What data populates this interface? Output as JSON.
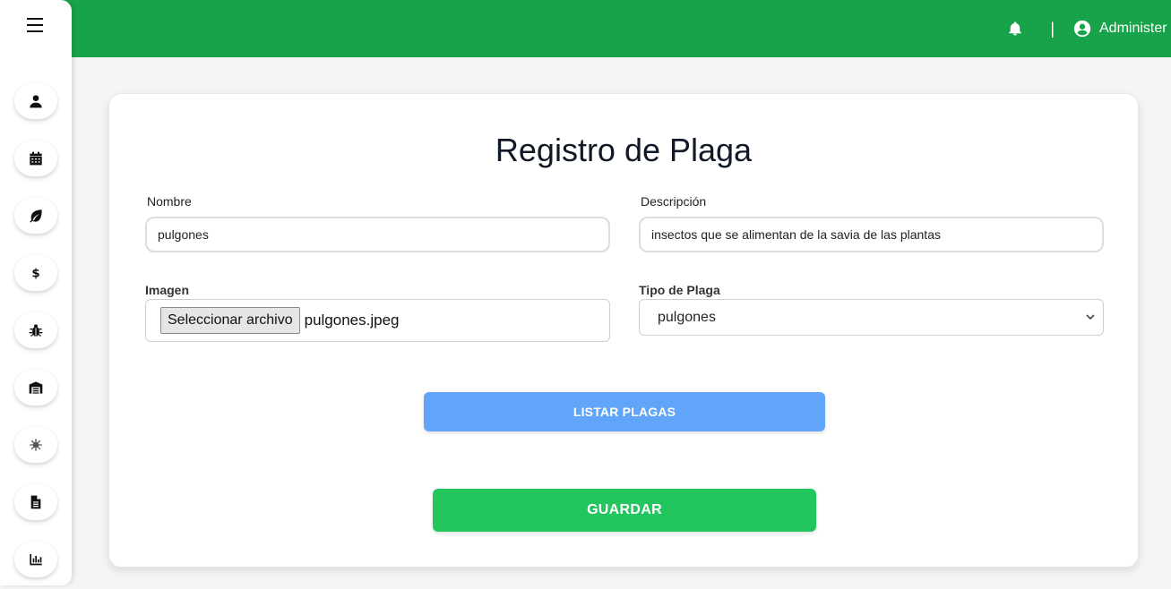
{
  "header": {
    "separator": "|",
    "user_name": "Administer"
  },
  "sidebar": {
    "items": [
      {
        "icon": "user-icon"
      },
      {
        "icon": "calendar-icon"
      },
      {
        "icon": "leaf-icon"
      },
      {
        "icon": "dollar-icon"
      },
      {
        "icon": "bug-icon"
      },
      {
        "icon": "warehouse-icon"
      },
      {
        "icon": "virus-icon"
      },
      {
        "icon": "file-icon"
      },
      {
        "icon": "chart-icon"
      }
    ]
  },
  "form": {
    "title": "Registro de Plaga",
    "nombre_label": "Nombre",
    "nombre_value": "pulgones",
    "descripcion_label": "Descripción",
    "descripcion_value": "insectos que se alimentan de la savia de las plantas",
    "imagen_label": "Imagen",
    "file_button": "Seleccionar archivo",
    "file_name": "pulgones.jpeg",
    "tipo_label": "Tipo de Plaga",
    "tipo_value": "pulgones",
    "list_button": "LISTAR PLAGAS",
    "save_button": "GUARDAR"
  },
  "colors": {
    "topbar": "#18a34a",
    "list_button": "#60a5fa",
    "save_button": "#22c55e"
  }
}
